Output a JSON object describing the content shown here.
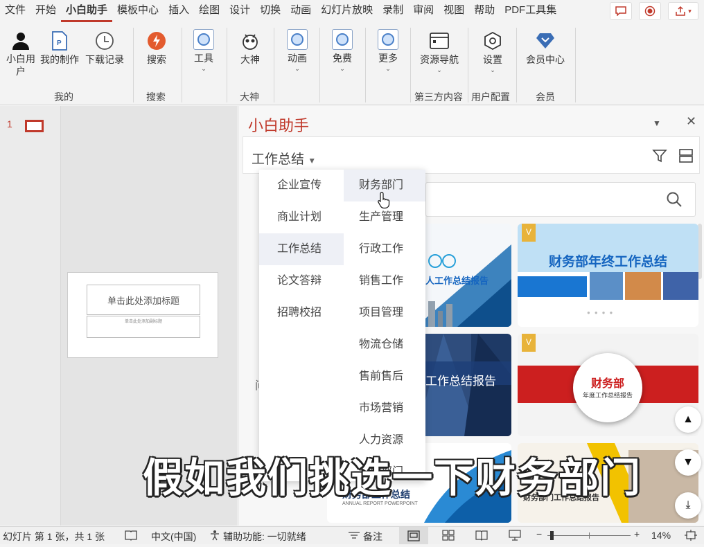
{
  "menu": {
    "items": [
      "文件",
      "开始",
      "小白助手",
      "模板中心",
      "插入",
      "绘图",
      "设计",
      "切换",
      "动画",
      "幻灯片放映",
      "录制",
      "审阅",
      "视图",
      "帮助",
      "PDF工具集"
    ],
    "active_index": 2
  },
  "ribbon": {
    "user_account": "小白用户",
    "my_works": "我的制作",
    "downloads": "下载记录",
    "search": "搜索",
    "tools": "工具",
    "master": "大神",
    "animation": "动画",
    "free": "免费",
    "more": "更多",
    "resource_nav": "资源导航",
    "settings": "设置",
    "membership": "会员中心",
    "groups": {
      "mine": "我的",
      "search": "搜索",
      "master": "大神",
      "third_party": "第三方内容",
      "user_config": "用户配置",
      "vip": "会员"
    }
  },
  "slides": {
    "number": "1",
    "title_placeholder": "单击此处添加标题",
    "subtitle_placeholder": "单击此处添加副标题"
  },
  "panel": {
    "title": "小白助手",
    "category": "工作总结",
    "left_hint": "问"
  },
  "dropdown": {
    "left": [
      "企业宣传",
      "商业计划",
      "工作总结",
      "论文答辩",
      "招聘校招"
    ],
    "right": [
      "财务部门",
      "生产管理",
      "行政工作",
      "销售工作",
      "项目管理",
      "物流仓储",
      "售前售后",
      "市场营销",
      "人力资源",
      "客服部门"
    ],
    "active_left": "工作总结",
    "hover_right": "财务部门",
    "pin": "下"
  },
  "cards": {
    "c1_text": "人工作总结报告",
    "c2_text": "财务部年终工作总结",
    "c3_text": "工作总结报告",
    "c4_title": "财务部",
    "c4_sub": "年度工作总结报告",
    "c5_title": "财务部工作总结",
    "c5_sub": "ANNUAL REPORT POWERPOINT",
    "c6_text": "财务部门工作总结报告",
    "badge": "V"
  },
  "status": {
    "slide_info": "幻灯片 第 1 张，共 1 张",
    "language": "中文(中国)",
    "accessibility": "辅助功能: 一切就绪",
    "notes": "备注",
    "zoom": "14%"
  },
  "caption": "假如我们挑选一下财务部门",
  "colors": {
    "accent": "#c0392b",
    "ribbon_icon": "#4a80c8",
    "vip": "#e8b33a"
  }
}
